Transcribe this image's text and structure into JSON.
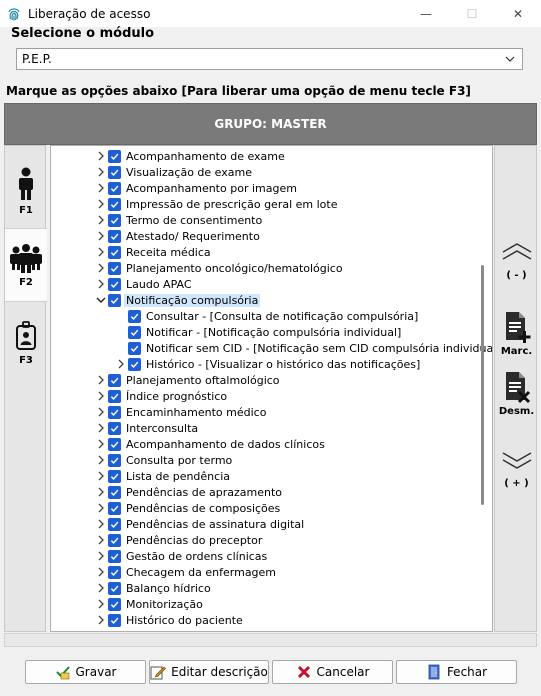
{
  "window": {
    "title": "Liberação de acesso",
    "minimize_glyph": "—",
    "maximize_glyph": "☐",
    "close_glyph": "✕"
  },
  "module": {
    "label": "Selecione o módulo",
    "selected": "P.E.P."
  },
  "instructions": "Marque as opções abaixo [Para liberar uma opção de menu tecle F3]",
  "group": {
    "header": "GRUPO: MASTER"
  },
  "left_panel": {
    "buttons": [
      {
        "label": "F1",
        "icon": "person-icon"
      },
      {
        "label": "F2",
        "icon": "group-icon"
      },
      {
        "label": "F3",
        "icon": "badge-icon"
      }
    ]
  },
  "tree": {
    "items": [
      {
        "label": "Acompanhamento de exame",
        "level": 0,
        "expander": "collapsed"
      },
      {
        "label": "Visualização de exame",
        "level": 0,
        "expander": "collapsed"
      },
      {
        "label": "Acompanhamento por imagem",
        "level": 0,
        "expander": "collapsed"
      },
      {
        "label": "Impressão de prescrição geral em lote",
        "level": 0,
        "expander": "collapsed"
      },
      {
        "label": "Termo de consentimento",
        "level": 0,
        "expander": "collapsed"
      },
      {
        "label": "Atestado/ Requerimento",
        "level": 0,
        "expander": "collapsed"
      },
      {
        "label": "Receita médica",
        "level": 0,
        "expander": "collapsed"
      },
      {
        "label": "Planejamento oncológico/hematológico",
        "level": 0,
        "expander": "collapsed"
      },
      {
        "label": "Laudo APAC",
        "level": 0,
        "expander": "collapsed"
      },
      {
        "label": "Notificação compulsória",
        "level": 0,
        "expander": "expanded",
        "selected": true
      },
      {
        "label": "Consultar - [Consulta de notificação compulsória]",
        "level": 1,
        "expander": "none"
      },
      {
        "label": "Notificar - [Notificação compulsória individual]",
        "level": 1,
        "expander": "none"
      },
      {
        "label": "Notificar sem CID - [Notificação sem CID compulsória individual]",
        "level": 1,
        "expander": "none"
      },
      {
        "label": "Histórico - [Visualizar o histórico das notificações]",
        "level": 1,
        "expander": "collapsed"
      },
      {
        "label": "Planejamento oftalmológico",
        "level": 0,
        "expander": "collapsed"
      },
      {
        "label": "Índice prognóstico",
        "level": 0,
        "expander": "collapsed"
      },
      {
        "label": "Encaminhamento médico",
        "level": 0,
        "expander": "collapsed"
      },
      {
        "label": "Interconsulta",
        "level": 0,
        "expander": "collapsed"
      },
      {
        "label": "Acompanhamento de dados clínicos",
        "level": 0,
        "expander": "collapsed"
      },
      {
        "label": "Consulta por termo",
        "level": 0,
        "expander": "collapsed"
      },
      {
        "label": "Lista de pendência",
        "level": 0,
        "expander": "collapsed"
      },
      {
        "label": "Pendências de aprazamento",
        "level": 0,
        "expander": "collapsed"
      },
      {
        "label": "Pendências de composições",
        "level": 0,
        "expander": "collapsed"
      },
      {
        "label": "Pendências de assinatura digital",
        "level": 0,
        "expander": "collapsed"
      },
      {
        "label": "Pendências do preceptor",
        "level": 0,
        "expander": "collapsed"
      },
      {
        "label": "Gestão de ordens clínicas",
        "level": 0,
        "expander": "collapsed"
      },
      {
        "label": "Checagem da enfermagem",
        "level": 0,
        "expander": "collapsed"
      },
      {
        "label": "Balanço hídrico",
        "level": 0,
        "expander": "collapsed"
      },
      {
        "label": "Monitorização",
        "level": 0,
        "expander": "collapsed"
      },
      {
        "label": "Histórico do paciente",
        "level": 0,
        "expander": "collapsed"
      }
    ]
  },
  "right_panel": {
    "collapse_label": "( - )",
    "mark_label": "Marc.",
    "unmark_label": "Desm.",
    "expand_label": "( + )"
  },
  "footer": {
    "save": "Gravar",
    "edit_description": "Editar descrição",
    "cancel": "Cancelar",
    "close": "Fechar"
  },
  "colors": {
    "checkbox": "#1e5fd6",
    "group_header": "#7a7a7a",
    "selection": "#cfe6fb"
  }
}
